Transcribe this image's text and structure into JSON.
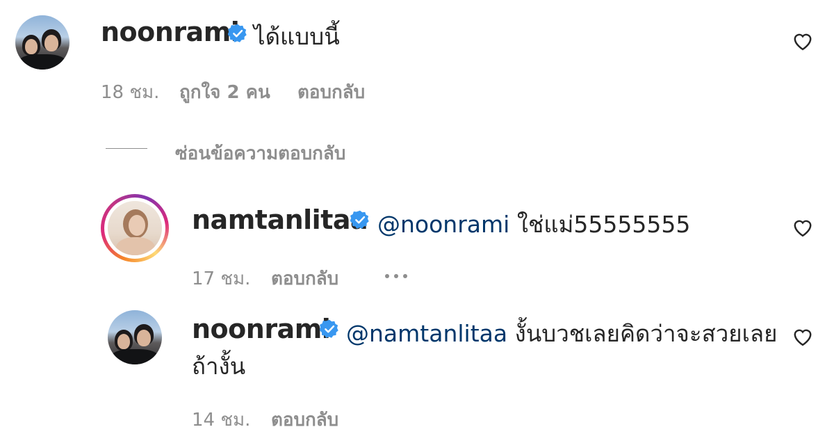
{
  "comments": [
    {
      "username": "noonrami",
      "text": "ได้แบบนี้",
      "time": "18 ชม.",
      "likes": "ถูกใจ 2 คน",
      "reply": "ตอบกลับ"
    }
  ],
  "hide_replies": "ซ่อนข้อความตอบกลับ",
  "replies": [
    {
      "username": "namtanlitaa",
      "mention": "@noonrami",
      "text": "ใช่แม่55555555",
      "time": "17 ชม.",
      "reply": "ตอบกลับ"
    },
    {
      "username": "noonrami",
      "mention": "@namtanlitaa",
      "text_line1": "งั้นบวชเลยคิดว่าจะสวยเลย",
      "text_line2": "ถ้างั้น",
      "time": "14 ชม.",
      "reply": "ตอบกลับ"
    }
  ],
  "icons": {
    "verified": "verified-badge-icon",
    "heart": "heart-outline-icon",
    "more": "more-options-icon"
  },
  "colors": {
    "verified_blue": "#3897f0",
    "mention": "#00376b",
    "meta_gray": "#8e8e8e"
  }
}
